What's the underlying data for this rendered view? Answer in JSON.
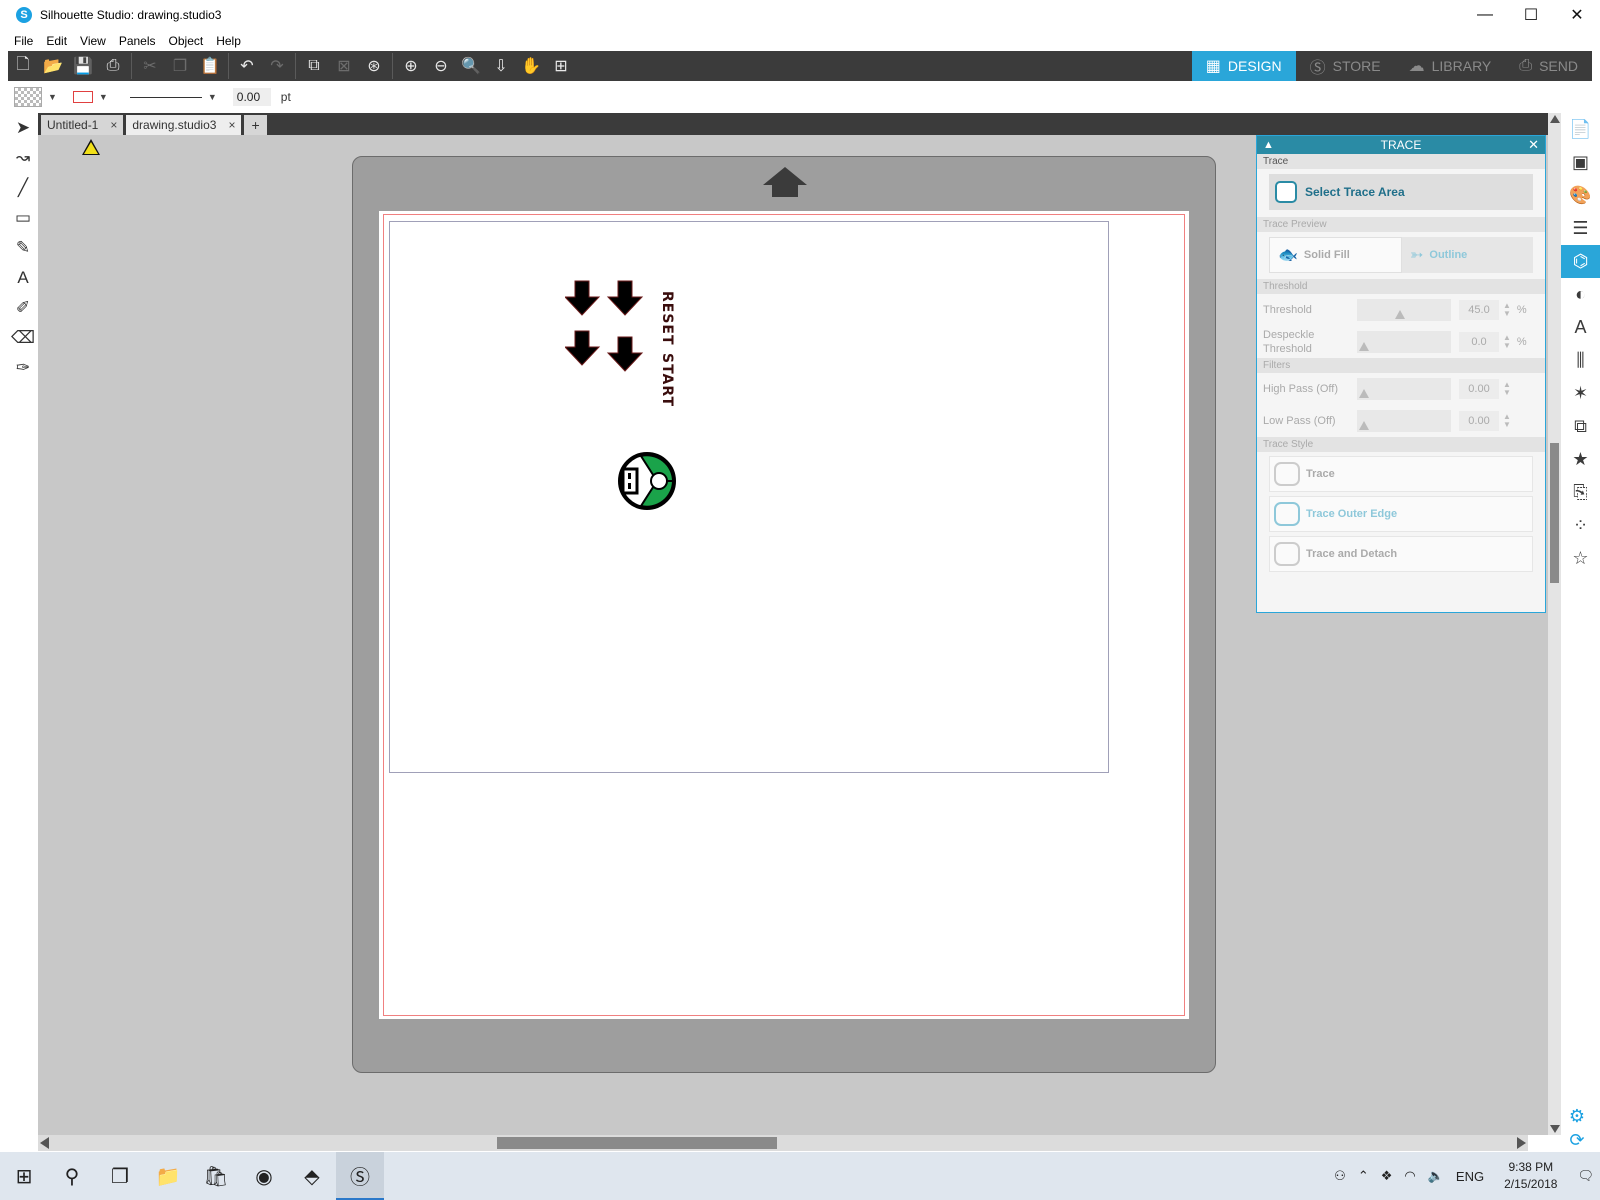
{
  "window": {
    "title": "Silhouette Studio: drawing.studio3",
    "minimize": "—",
    "maximize": "☐",
    "close": "✕"
  },
  "menu": [
    "File",
    "Edit",
    "View",
    "Panels",
    "Object",
    "Help"
  ],
  "modes": [
    {
      "label": "DESIGN",
      "icon": "grid-icon",
      "glyph": "▦",
      "active": true
    },
    {
      "label": "STORE",
      "icon": "store-icon",
      "glyph": "Ⓢ",
      "active": false
    },
    {
      "label": "LIBRARY",
      "icon": "cloud-icon",
      "glyph": "☁",
      "active": false
    },
    {
      "label": "SEND",
      "icon": "cutter-icon",
      "glyph": "⎙",
      "active": false
    }
  ],
  "subbar": {
    "stroke_value": "0.00",
    "unit": "pt"
  },
  "tabs": [
    {
      "label": "Untitled-1",
      "close": "×"
    },
    {
      "label": "drawing.studio3",
      "close": "×"
    },
    {
      "label": "+"
    }
  ],
  "design": {
    "label1": "RESET",
    "label2": "START"
  },
  "trace_panel": {
    "title": "TRACE",
    "section_trace": "Trace",
    "select_area": "Select Trace Area",
    "section_preview": "Trace Preview",
    "solid_fill": "Solid Fill",
    "outline": "Outline",
    "section_threshold": "Threshold",
    "threshold_label": "Threshold",
    "threshold_value": "45.0",
    "threshold_level": 0.45,
    "despeckle_label": "Despeckle Threshold",
    "despeckle_value": "0.0",
    "section_filters": "Filters",
    "high_pass_label": "High Pass (Off)",
    "high_pass_value": "0.00",
    "low_pass_label": "Low Pass (Off)",
    "low_pass_value": "0.00",
    "section_style": "Trace Style",
    "style_trace": "Trace",
    "style_outer": "Trace Outer Edge",
    "style_detach": "Trace and Detach",
    "percent": "%"
  },
  "taskbar": {
    "lang": "ENG",
    "time": "9:38 PM",
    "date": "2/15/2018"
  }
}
